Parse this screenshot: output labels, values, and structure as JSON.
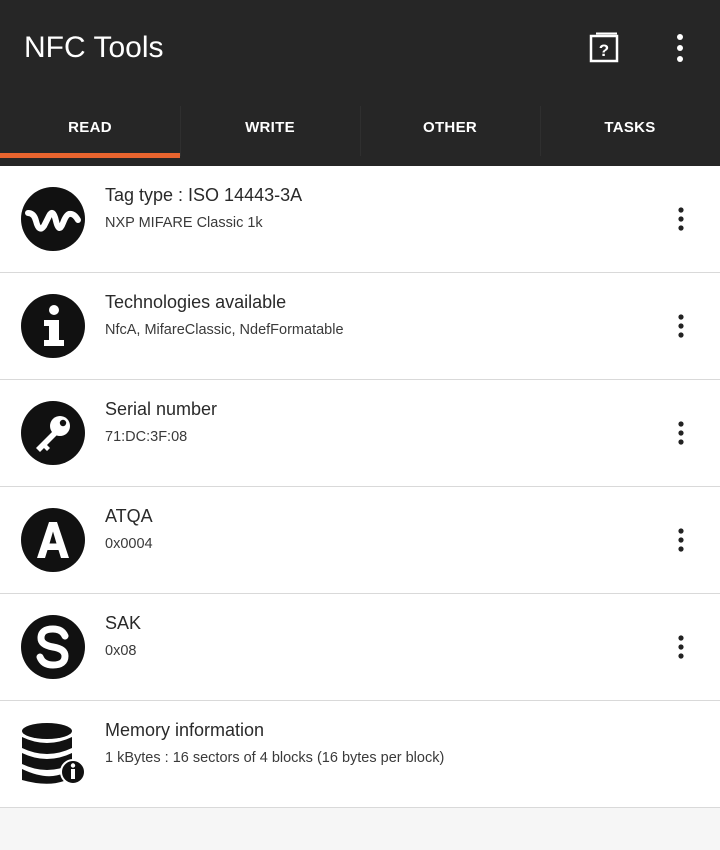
{
  "app": {
    "title": "NFC Tools"
  },
  "toolbar": {
    "help_icon": "help-icon",
    "overflow_icon": "more-vert-icon"
  },
  "tabs": [
    {
      "label": "READ",
      "active": true
    },
    {
      "label": "WRITE",
      "active": false
    },
    {
      "label": "OTHER",
      "active": false
    },
    {
      "label": "TASKS",
      "active": false
    }
  ],
  "accent_color": "#e8642e",
  "items": [
    {
      "title": "Tag type : ISO 14443-3A",
      "subtitle": "NXP MIFARE Classic 1k",
      "icon": "waveform-icon",
      "has_menu": true
    },
    {
      "title": "Technologies available",
      "subtitle": "NfcA, MifareClassic, NdefFormatable",
      "icon": "info-icon",
      "has_menu": true
    },
    {
      "title": "Serial number",
      "subtitle": "71:DC:3F:08",
      "icon": "key-icon",
      "has_menu": true
    },
    {
      "title": "ATQA",
      "subtitle": "0x0004",
      "icon": "letter-a-icon",
      "has_menu": true
    },
    {
      "title": "SAK",
      "subtitle": "0x08",
      "icon": "letter-s-icon",
      "has_menu": true
    },
    {
      "title": "Memory information",
      "subtitle": "1 kBytes : 16 sectors of 4 blocks (16 bytes per block)",
      "icon": "database-info-icon",
      "has_menu": false
    }
  ]
}
